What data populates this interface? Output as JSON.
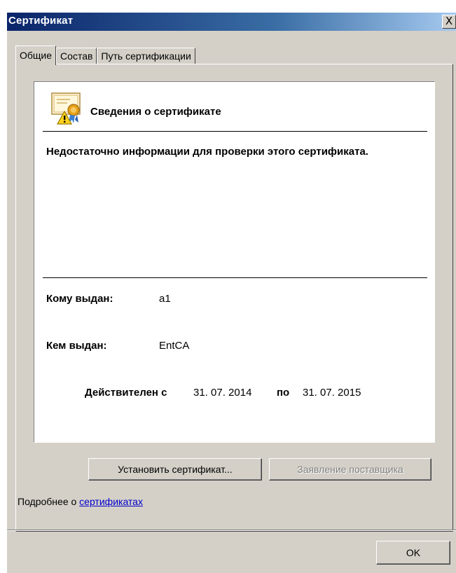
{
  "window": {
    "title": "Сертификат",
    "close_glyph": "X"
  },
  "tabs": [
    {
      "label": "Общие",
      "active": true
    },
    {
      "label": "Состав",
      "active": false
    },
    {
      "label": "Путь сертификации",
      "active": false
    }
  ],
  "info": {
    "icon": "certificate-warning-icon",
    "title": "Сведения о сертификате",
    "message": "Недостаточно информации для проверки этого сертификата.",
    "issued_to_label": "Кому выдан:",
    "issued_to_value": "a1",
    "issued_by_label": "Кем выдан:",
    "issued_by_value": "EntCA",
    "valid_from_label": "Действителен с",
    "valid_from_value": "31. 07. 2014",
    "valid_to_label": "по",
    "valid_to_value": "31. 07. 2015"
  },
  "buttons": {
    "install": "Установить сертификат...",
    "issuer_statement": "Заявление поставщика",
    "ok": "OK"
  },
  "footer": {
    "learn_more_prefix": "Подробнее о ",
    "learn_more_link": "сертификатах"
  },
  "colors": {
    "dialog_face": "#d4d0c8",
    "title_start": "#0a246a",
    "title_end": "#a6caf0",
    "link": "#0000cc"
  }
}
